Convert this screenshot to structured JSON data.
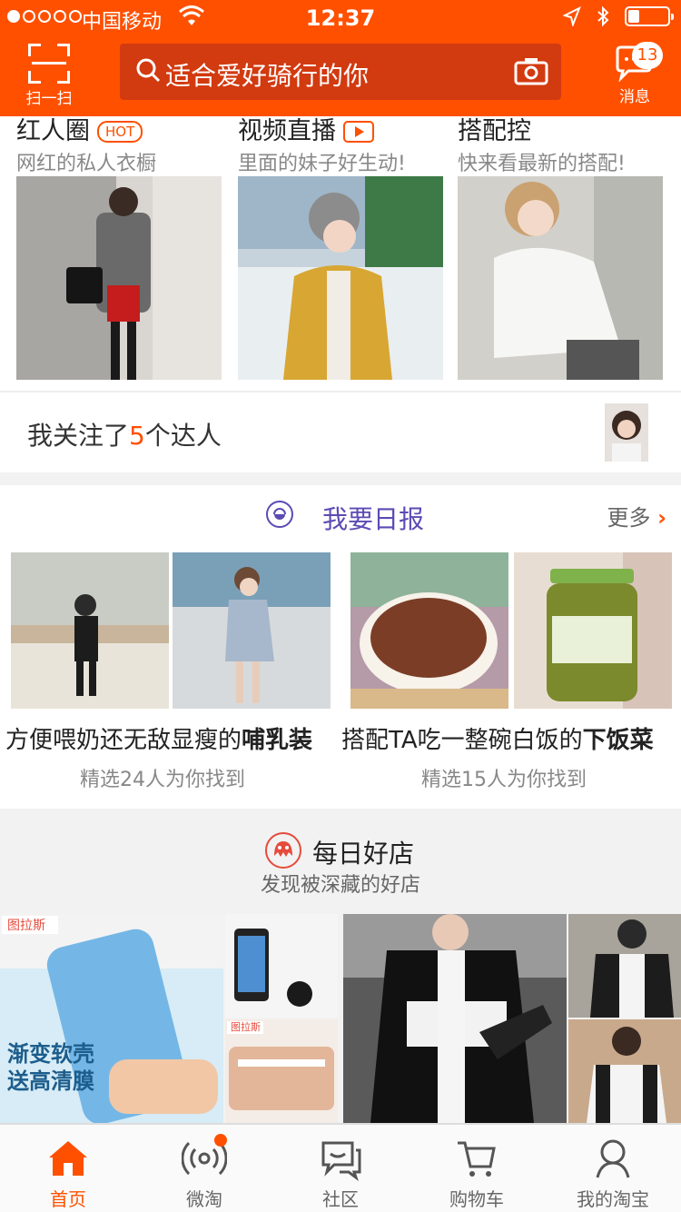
{
  "status_bar": {
    "carrier": "中国移动",
    "time": "12:37"
  },
  "header": {
    "scan_label": "扫一扫",
    "search_placeholder": "适合爱好骑行的你",
    "message_label": "消息",
    "message_count": "13"
  },
  "features": [
    {
      "title": "红人圈",
      "badge": "HOT",
      "subtitle": "网红的私人衣橱"
    },
    {
      "title": "视频直播",
      "subtitle": "里面的妹子好生动!"
    },
    {
      "title": "搭配控",
      "subtitle": "快来看最新的搭配!"
    }
  ],
  "follow": {
    "prefix": "我关注了",
    "count": "5",
    "suffix": "个达人"
  },
  "daily": {
    "title": "我要日报",
    "more_label": "更多",
    "items": [
      {
        "caption_plain": "方便喂奶还无敌显瘦的",
        "caption_bold": "哺乳装",
        "sub": "精选24人为你找到"
      },
      {
        "caption_plain": "搭配TA吃一整碗白饭的",
        "caption_bold": "下饭菜",
        "sub": "精选15人为你找到"
      }
    ]
  },
  "shop": {
    "title": "每日好店",
    "subtitle": "发现被深藏的好店",
    "tile1_brand": "图拉斯",
    "tile1_line1": "渐变软壳",
    "tile1_line2": "送高清膜",
    "tile2_brand": "图拉斯"
  },
  "tabbar": [
    {
      "label": "首页",
      "icon": "home-icon",
      "active": true
    },
    {
      "label": "微淘",
      "icon": "broadcast-icon"
    },
    {
      "label": "社区",
      "icon": "chat-icon"
    },
    {
      "label": "购物车",
      "icon": "cart-icon"
    },
    {
      "label": "我的淘宝",
      "icon": "user-icon"
    }
  ],
  "colors": {
    "brand": "#ff5000",
    "daily_title": "#5b4bb3"
  }
}
